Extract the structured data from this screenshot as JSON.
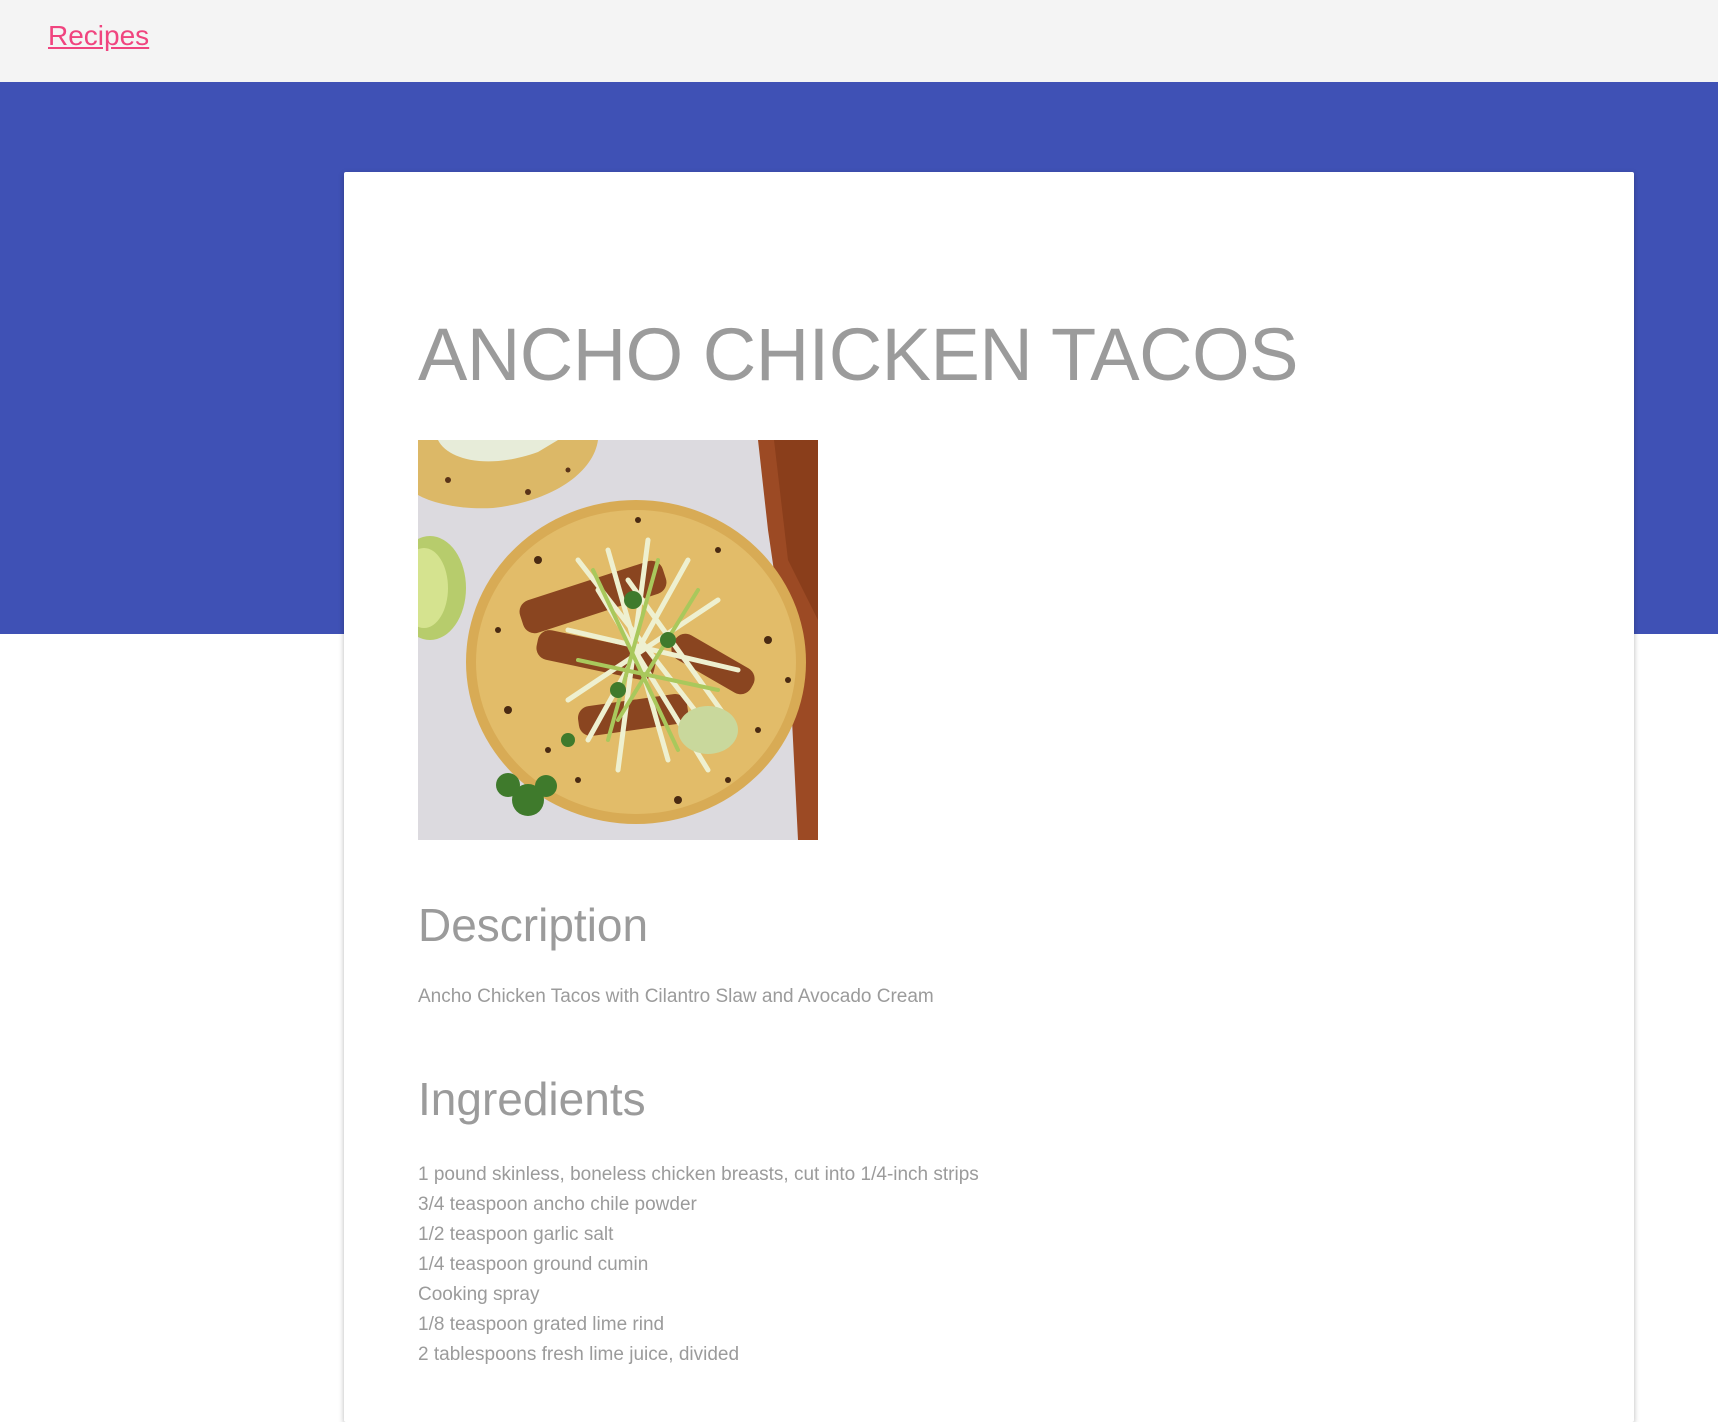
{
  "nav": {
    "recipes_link": "Recipes"
  },
  "colors": {
    "hero": "#3f51b5",
    "link": "#f0447f",
    "text": "#9b9b9b",
    "topbar": "#f4f4f4"
  },
  "recipe": {
    "title": "ANCHO CHICKEN TACOS",
    "image_alt": "Ancho chicken taco with cilantro slaw",
    "description_heading": "Description",
    "description": "Ancho Chicken Tacos with Cilantro Slaw and Avocado Cream",
    "ingredients_heading": "Ingredients",
    "ingredients": [
      "1 pound skinless, boneless chicken breasts, cut into 1/4-inch strips",
      "3/4 teaspoon ancho chile powder",
      "1/2 teaspoon garlic salt",
      "1/4 teaspoon ground cumin",
      "Cooking spray",
      "1/8 teaspoon grated lime rind",
      "2 tablespoons fresh lime juice, divided"
    ]
  }
}
